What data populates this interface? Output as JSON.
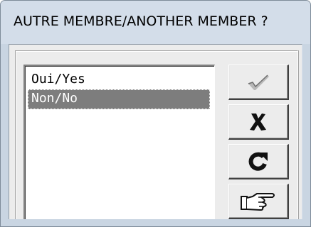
{
  "window": {
    "title": "AUTRE MEMBRE/ANOTHER MEMBER ?"
  },
  "list": {
    "items": [
      {
        "label": "Oui/Yes",
        "selected": false
      },
      {
        "label": "Non/No",
        "selected": true
      }
    ]
  },
  "buttons": [
    {
      "icon": "checkmark-icon"
    },
    {
      "icon": "x-cancel-icon"
    },
    {
      "icon": "refresh-icon"
    },
    {
      "icon": "pointing-hand-icon"
    }
  ],
  "colors": {
    "titlebar": "#d3dde9",
    "client": "#ececec",
    "selection": "#7d7d7d"
  }
}
